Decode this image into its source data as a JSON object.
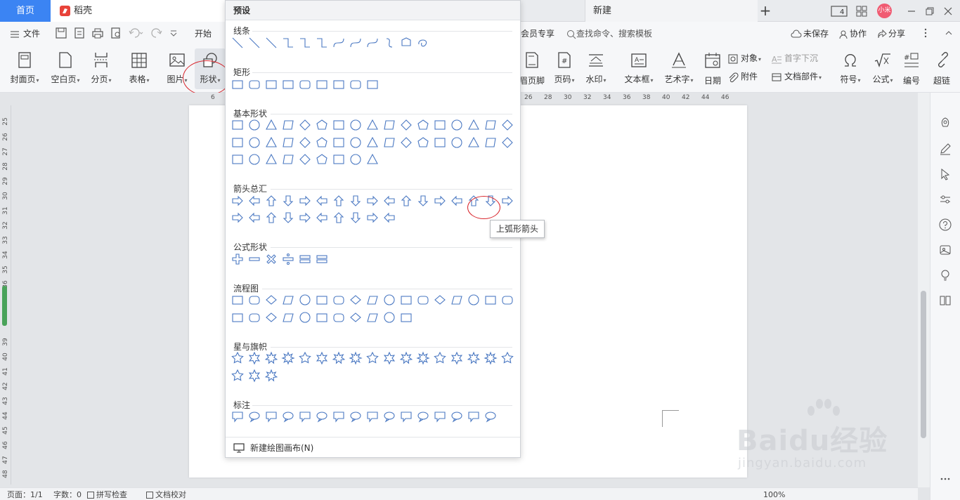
{
  "titlebar": {
    "home_tab": "首页",
    "docer_tab": "稻壳",
    "new_tab": "新建",
    "plus": "+",
    "page_counter": "4",
    "avatar_text": "小米"
  },
  "toolbar": {
    "file": "文件",
    "start": "开始",
    "member": "会员专享",
    "search_placeholder": "查找命令、搜索模板",
    "unsaved": "未保存",
    "collab": "协作",
    "share": "分享"
  },
  "ribbon": {
    "cover": "封面页",
    "blank": "空白页",
    "pagebreak": "分页",
    "table": "表格",
    "image": "图片",
    "shape": "形状",
    "header_footer": "眉页脚",
    "page_number": "页码",
    "watermark": "水印",
    "textbox": "文本框",
    "wordart": "艺术字",
    "date": "日期",
    "object": "对象",
    "dropcap": "首字下沉",
    "attachment": "附件",
    "doc_parts": "文档部件",
    "symbol": "符号",
    "formula": "公式",
    "numbering": "编号",
    "hyperlink": "超链"
  },
  "ruler": {
    "marks": [
      "6",
      "26",
      "28",
      "30",
      "32",
      "34",
      "36",
      "38",
      "40",
      "42",
      "44",
      "46"
    ],
    "vmarks": [
      "25",
      "26",
      "27",
      "28",
      "29",
      "30",
      "31",
      "32",
      "33",
      "34",
      "35",
      "36",
      "37",
      "39",
      "40",
      "41",
      "42",
      "43",
      "44",
      "45",
      "46",
      "47",
      "48"
    ]
  },
  "dropdown": {
    "title": "预设",
    "sections": {
      "lines": "线条",
      "rect": "矩形",
      "basic": "基本形状",
      "arrows": "箭头总汇",
      "formula": "公式形状",
      "flow": "流程图",
      "stars": "星与旗帜",
      "callouts": "标注"
    },
    "tooltip": "上弧形箭头",
    "footer": "新建绘图画布(N)"
  },
  "statusbar": {
    "page": "页面：1/1",
    "words": "字数：0",
    "spellcheck": "拼写检查",
    "doc_check": "文档校对",
    "zoom": "100%"
  },
  "watermark": {
    "main": "Baidu经验",
    "sub": "jingyan.baidu.com"
  },
  "colors": {
    "accent": "#3b84f3",
    "shape_stroke": "#4a78c2",
    "highlight_red": "#d9272e"
  }
}
